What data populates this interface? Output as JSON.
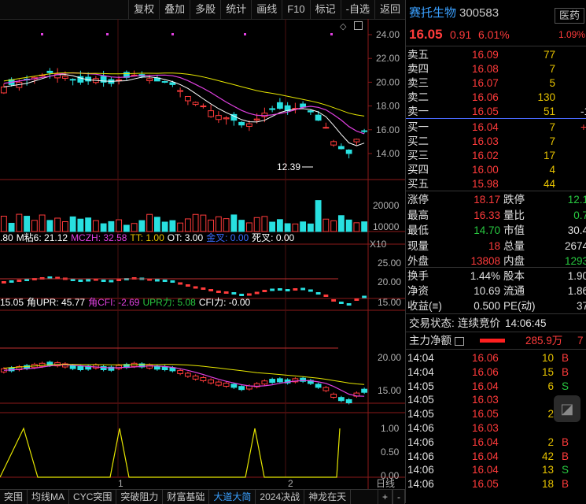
{
  "toolbar": {
    "buttons": [
      "复权",
      "叠加",
      "多股",
      "统计",
      "画线",
      "F10",
      "标记",
      "-自选",
      "返回"
    ]
  },
  "price_axis": [
    "24.00",
    "22.00",
    "20.00",
    "18.00",
    "16.00",
    "14.00"
  ],
  "volume_axis": [
    "20000",
    "10000"
  ],
  "volume_unit": "X10",
  "low_annotation": "12.39",
  "indicator1": {
    "label_prefix": ".80",
    "items": [
      {
        "text": "M粘6: 21.12",
        "color": "#ffffff"
      },
      {
        "text": "MCZH: 32.58",
        "color": "#e040e0"
      },
      {
        "text": "TT: 1.00",
        "color": "#e6c200"
      },
      {
        "text": "OT: 3.00",
        "color": "#ffffff"
      },
      {
        "text": "金叉: 0.00",
        "color": "#3a6cff"
      },
      {
        "text": "死叉: 0.00",
        "color": "#ffffff"
      }
    ],
    "axis": [
      "25.00",
      "20.00",
      "15.00"
    ]
  },
  "indicator2": {
    "items": [
      {
        "text": "15.05",
        "color": "#ffffff"
      },
      {
        "text": "角UPR: 45.77",
        "color": "#ffffff"
      },
      {
        "text": "角CFI: -2.69",
        "color": "#e040e0"
      },
      {
        "text": "UPR力: 5.08",
        "color": "#28c840"
      },
      {
        "text": "CFI力: -0.00",
        "color": "#ffffff"
      }
    ],
    "axis": [
      "20.00",
      "15.00"
    ]
  },
  "indicator3": {
    "axis": [
      "1.00",
      "0.50",
      "0.00"
    ]
  },
  "x_axis_labels": [
    "1",
    "2"
  ],
  "period_label": "日线",
  "tabs": [
    "突围",
    "均线MA",
    "CYC突围",
    "突破阻力",
    "财富基础",
    "大道大简",
    "2024决战",
    "神龙在天"
  ],
  "active_tab": "大道大简",
  "scroll_buttons": [
    "+",
    "-"
  ],
  "stock": {
    "name": "赛托生物",
    "code": "300583",
    "sector": "医药",
    "sector_change": "1.09%",
    "price": "16.05",
    "change": "0.91",
    "change_pct": "6.01%"
  },
  "asks": [
    {
      "label": "卖五",
      "price": "16.09",
      "vol": "77",
      "extra": ""
    },
    {
      "label": "卖四",
      "price": "16.08",
      "vol": "7",
      "extra": ""
    },
    {
      "label": "卖三",
      "price": "16.07",
      "vol": "5",
      "extra": ""
    },
    {
      "label": "卖二",
      "price": "16.06",
      "vol": "130",
      "extra": ""
    },
    {
      "label": "卖一",
      "price": "16.05",
      "vol": "51",
      "extra": "-1"
    }
  ],
  "bids": [
    {
      "label": "买一",
      "price": "16.04",
      "vol": "7",
      "extra": "+"
    },
    {
      "label": "买二",
      "price": "16.03",
      "vol": "7",
      "extra": ""
    },
    {
      "label": "买三",
      "price": "16.02",
      "vol": "17",
      "extra": ""
    },
    {
      "label": "买四",
      "price": "16.00",
      "vol": "4",
      "extra": ""
    },
    {
      "label": "买五",
      "price": "15.98",
      "vol": "44",
      "extra": ""
    }
  ],
  "stats": [
    {
      "l1": "涨停",
      "v1": "18.17",
      "c1": "red",
      "l2": "跌停",
      "v2": "12.1",
      "c2": "green"
    },
    {
      "l1": "最高",
      "v1": "16.33",
      "c1": "red",
      "l2": "量比",
      "v2": "0.7",
      "c2": "green"
    },
    {
      "l1": "最低",
      "v1": "14.70",
      "c1": "green",
      "l2": "市值",
      "v2": "30.4",
      "c2": "white"
    },
    {
      "l1": "现量",
      "v1": "18",
      "c1": "red",
      "l2": "总量",
      "v2": "2674",
      "c2": "white"
    },
    {
      "l1": "外盘",
      "v1": "13808",
      "c1": "red",
      "l2": "内盘",
      "v2": "1293",
      "c2": "green"
    }
  ],
  "stats2": [
    {
      "l1": "换手",
      "v1": "1.44%",
      "l2": "股本",
      "v2": "1.90"
    },
    {
      "l1": "净资",
      "v1": "10.69",
      "l2": "流通",
      "v2": "1.86"
    },
    {
      "l1": "收益(≡)",
      "v1": "0.500",
      "l2": "PE(动)",
      "v2": "37"
    }
  ],
  "trade_status": {
    "label": "交易状态:",
    "value": "连续竞价",
    "time": "14:06:45"
  },
  "main_flow": {
    "label": "主力净额",
    "value": "285.9万",
    "extra": "7"
  },
  "ticks": [
    {
      "time": "14:04",
      "price": "16.06",
      "vol": "10",
      "side": "B"
    },
    {
      "time": "14:04",
      "price": "16.06",
      "vol": "15",
      "side": "B"
    },
    {
      "time": "14:05",
      "price": "16.04",
      "vol": "6",
      "side": "S"
    },
    {
      "time": "14:05",
      "price": "16.03",
      "vol": "",
      "side": ""
    },
    {
      "time": "14:05",
      "price": "16.05",
      "vol": "2",
      "side": ""
    },
    {
      "time": "14:06",
      "price": "16.03",
      "vol": "",
      "side": ""
    },
    {
      "time": "14:06",
      "price": "16.04",
      "vol": "2",
      "side": "B"
    },
    {
      "time": "14:06",
      "price": "16.04",
      "vol": "42",
      "side": "B"
    },
    {
      "time": "14:06",
      "price": "16.04",
      "vol": "13",
      "side": "S"
    },
    {
      "time": "14:06",
      "price": "16.05",
      "vol": "18",
      "side": "B"
    }
  ],
  "colors": {
    "up": "#ff3b3b",
    "down": "#28e0e0",
    "ma_white": "#ffffff",
    "ma_yellow": "#e6e600",
    "ma_magenta": "#e040e0"
  }
}
